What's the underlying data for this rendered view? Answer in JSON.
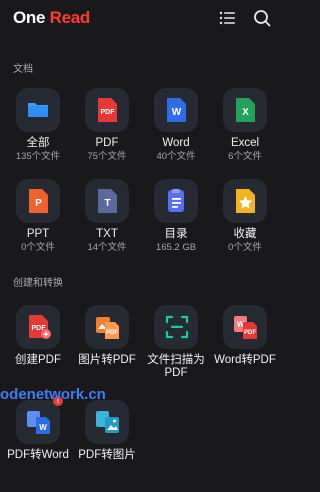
{
  "header": {
    "brand_part1": "One",
    "brand_part2": "Read",
    "list_icon": "list-icon",
    "search_icon": "search-icon"
  },
  "sections": {
    "documents": {
      "title": "文档",
      "items": [
        {
          "label": "全部",
          "count": "135个文件",
          "icon": "folder-icon",
          "color": "#2e8ff0"
        },
        {
          "label": "PDF",
          "count": "75个文件",
          "icon": "pdf-icon",
          "color": "#e53935"
        },
        {
          "label": "Word",
          "count": "40个文件",
          "icon": "word-icon",
          "color": "#2f6be6"
        },
        {
          "label": "Excel",
          "count": "6个文件",
          "icon": "excel-icon",
          "color": "#22a35b"
        },
        {
          "label": "PPT",
          "count": "0个文件",
          "icon": "ppt-icon",
          "color": "#f0612f"
        },
        {
          "label": "TXT",
          "count": "14个文件",
          "icon": "txt-icon",
          "color": "#5b6a9c"
        },
        {
          "label": "目录",
          "count": "165.2 GB",
          "icon": "directory-icon",
          "color": "#5c6ef0"
        },
        {
          "label": "收藏",
          "count": "0个文件",
          "icon": "favorites-star-icon",
          "color": "#f2b51f"
        }
      ]
    },
    "create_convert": {
      "title": "创建和转换",
      "items": [
        {
          "label": "创建PDF",
          "icon": "create-pdf-icon"
        },
        {
          "label": "图片转PDF",
          "icon": "image-to-pdf-icon"
        },
        {
          "label": "文件扫描为PDF",
          "icon": "scan-to-pdf-icon"
        },
        {
          "label": "Word转PDF",
          "icon": "word-to-pdf-icon"
        },
        {
          "label": "PDF转Word",
          "icon": "pdf-to-word-icon",
          "badge": "!"
        },
        {
          "label": "PDF转图片",
          "icon": "pdf-to-image-icon"
        }
      ]
    }
  },
  "watermark": "odenetwork.cn"
}
